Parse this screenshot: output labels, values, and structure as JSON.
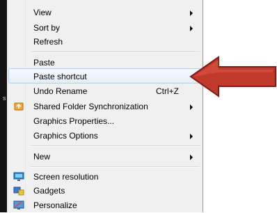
{
  "menu": {
    "view": "View",
    "sort_by": "Sort by",
    "refresh": "Refresh",
    "paste": "Paste",
    "paste_shortcut": "Paste shortcut",
    "undo_rename": "Undo Rename",
    "undo_rename_shortcut": "Ctrl+Z",
    "shared_folder_sync": "Shared Folder Synchronization",
    "graphics_properties": "Graphics Properties...",
    "graphics_options": "Graphics Options",
    "new": "New",
    "screen_resolution": "Screen resolution",
    "gadgets": "Gadgets",
    "personalize": "Personalize"
  },
  "desktop": {
    "edge_glyph": "s"
  },
  "icons": {
    "shared_folder_sync": "sync-folder-icon",
    "screen_resolution": "monitor-icon",
    "gadgets": "gadgets-icon",
    "personalize": "personalize-icon"
  },
  "colors": {
    "menu_bg": "#f0f0f0",
    "highlight_border": "#aecff7",
    "callout_arrow": "#c0392b"
  }
}
